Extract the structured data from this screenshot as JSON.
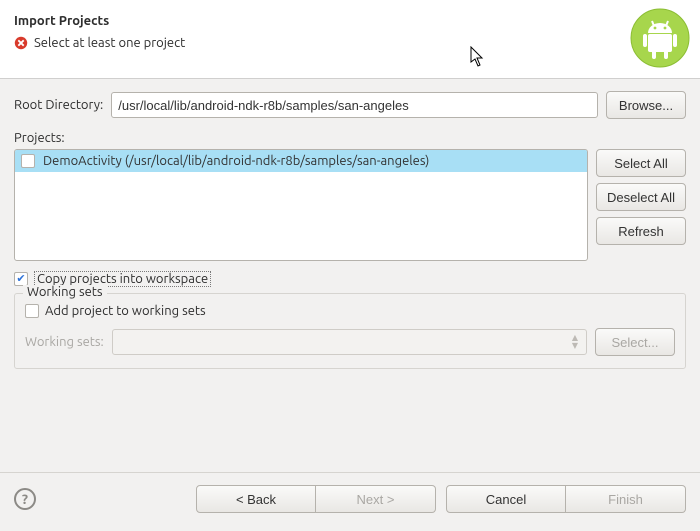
{
  "header": {
    "title": "Import Projects",
    "subtitle": "Select at least one project"
  },
  "rootDir": {
    "label": "Root Directory:",
    "value": "/usr/local/lib/android-ndk-r8b/samples/san-angeles",
    "browse": "Browse..."
  },
  "projects": {
    "label": "Projects:",
    "items": [
      {
        "checked": false,
        "label": "DemoActivity (/usr/local/lib/android-ndk-r8b/samples/san-angeles)"
      }
    ],
    "selectAll": "Select All",
    "deselectAll": "Deselect All",
    "refresh": "Refresh"
  },
  "copyProjects": {
    "checked": true,
    "label": "Copy projects into workspace"
  },
  "workingSets": {
    "groupTitle": "Working sets",
    "addChecked": false,
    "addLabel": "Add project to working sets",
    "comboLabel": "Working sets:",
    "selectBtn": "Select..."
  },
  "footer": {
    "back": "< Back",
    "next": "Next >",
    "cancel": "Cancel",
    "finish": "Finish"
  }
}
